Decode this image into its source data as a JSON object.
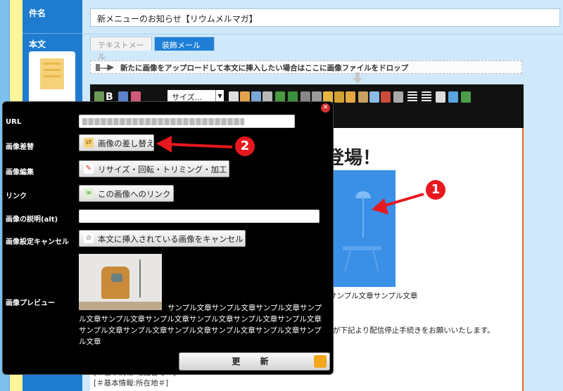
{
  "labels": {
    "subject": "件名",
    "body": "本文"
  },
  "subject_value": "新メニューのお知らせ【リウムメルマガ】",
  "tabs": {
    "text": "テキストメール",
    "deco": "装飾メール"
  },
  "dropbar_text": "新たに画像をアップロードして本文に挿入したい場合はここに画像ファイルをドロップ",
  "toolbar": {
    "size_label": "サイズ..."
  },
  "editor": {
    "heading": "登場！",
    "line1": "サンプル文章サンプル文章",
    "line2": "が下記より配信停止手続きをお願いいたします。",
    "line3": "[＃基本情報:所在地＃]",
    "line4": "[＃基本情報:電話番号＃]"
  },
  "modal": {
    "rows": {
      "url": "URL",
      "replace": "画像差替",
      "edit": "画像編集",
      "link": "リンク",
      "alt": "画像の説明(alt)",
      "cancel": "画像設定キャンセル",
      "preview": "画像プレビュー"
    },
    "buttons": {
      "replace": "画像の差し替え",
      "edit": "リサイズ・回転・トリミング・加工",
      "link": "この画像へのリンク",
      "cancel": "本文に挿入されている画像をキャンセル",
      "update": "更 新"
    },
    "preview_text": "サンプル文章サンプル文章サンプル文章サンプル文章サンプル文章サンプル文章サンプル文章サンプル文章サンプル文章サンプル文章サンプル文章サンプル文章サンプル文章サンプル文章サンプル文章"
  },
  "callouts": {
    "one": "1",
    "two": "2"
  },
  "colors": {
    "accent": "#1f7fd8",
    "callout": "#e8181f",
    "modal_bg": "#000000"
  }
}
